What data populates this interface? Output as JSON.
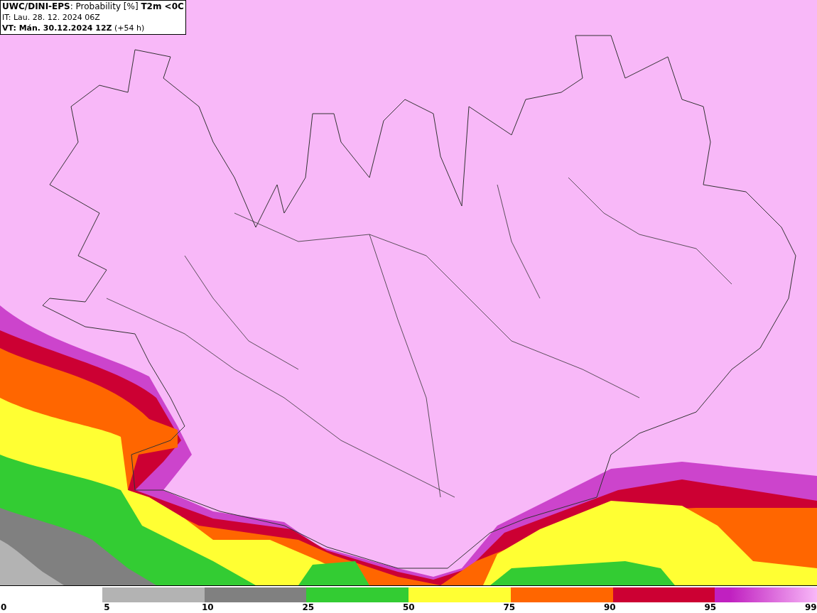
{
  "header": {
    "lines": [
      "**UWC/DINI-EPS**: Probability [%] **T2m <0C**",
      "IT: Lau. 28. 12. 2024 06Z",
      "**VT: Mán. 30.12.2024 12Z** (+54 h)"
    ]
  },
  "legend": {
    "segments": [
      {
        "kind": "blank"
      },
      {
        "kind": "solid",
        "color": "#b3b3b3"
      },
      {
        "kind": "solid",
        "color": "#808080"
      },
      {
        "kind": "solid",
        "color": "#33cc33"
      },
      {
        "kind": "solid",
        "color": "#ffff33"
      },
      {
        "kind": "solid",
        "color": "#ff6600"
      },
      {
        "kind": "solid",
        "color": "#cc0033"
      },
      {
        "kind": "gradient",
        "color": "#c020c0"
      }
    ],
    "labels": [
      "0",
      "5",
      "10",
      "25",
      "50",
      "75",
      "90",
      "95",
      "99"
    ]
  }
}
